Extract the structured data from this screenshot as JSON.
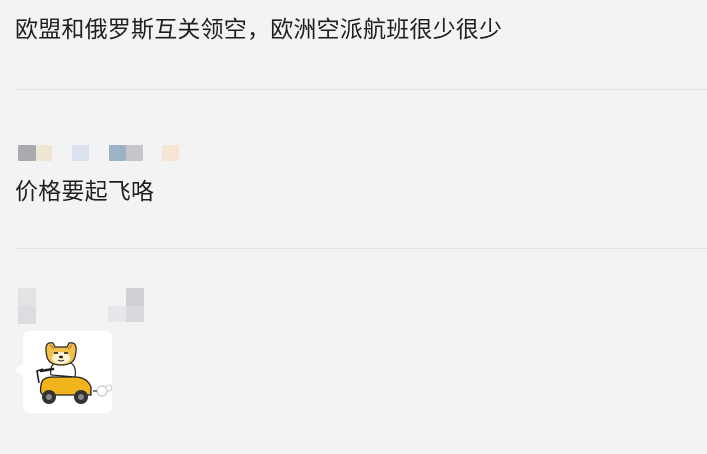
{
  "comments": [
    {
      "text": "欧盟和俄罗斯互关领空，欧洲空派航班很少很少"
    },
    {
      "text": "价格要起飞咯"
    }
  ],
  "sticker": {
    "icon": "shiba-scooter-icon"
  },
  "colors": {
    "background": "#f3f3f4",
    "divider": "#e2e2e4",
    "text": "#1f1f1f"
  }
}
